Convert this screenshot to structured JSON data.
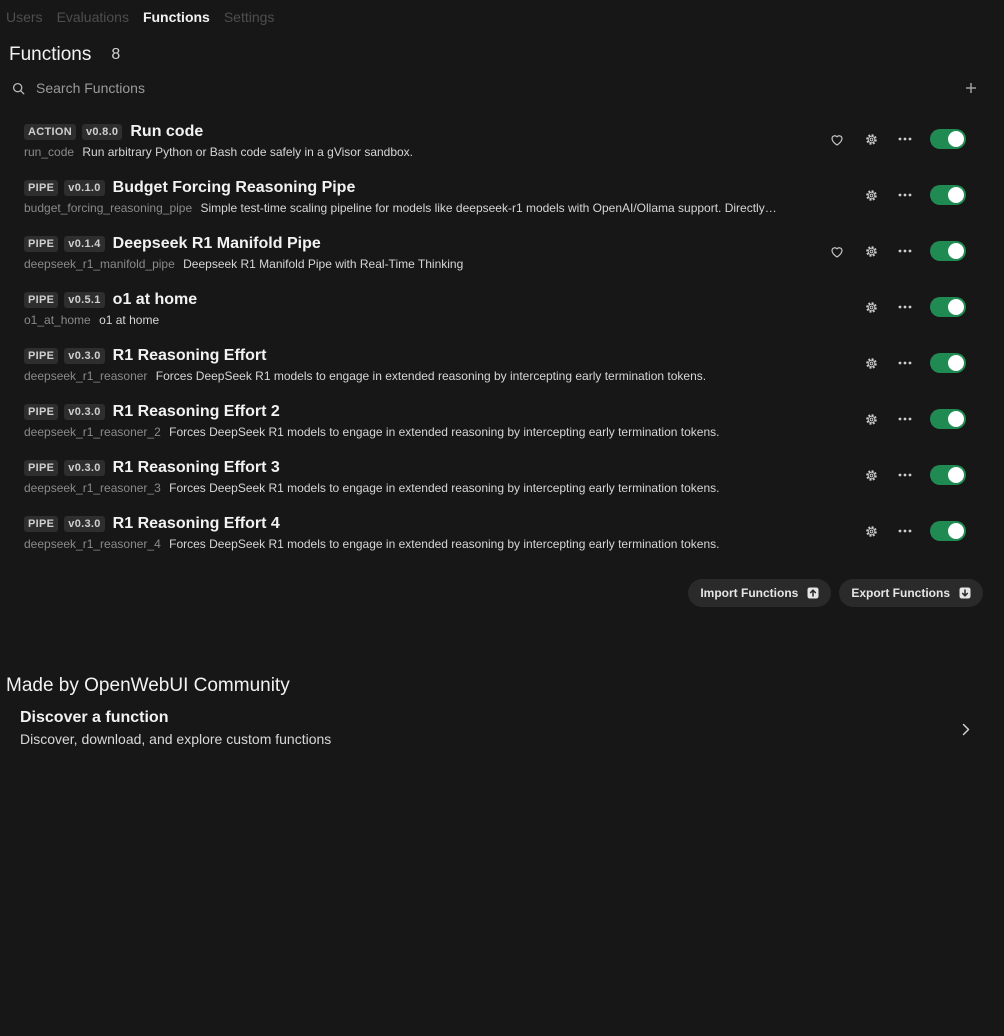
{
  "tabs": [
    {
      "label": "Users",
      "active": false
    },
    {
      "label": "Evaluations",
      "active": false
    },
    {
      "label": "Functions",
      "active": true
    },
    {
      "label": "Settings",
      "active": false
    }
  ],
  "heading": {
    "title": "Functions",
    "count": "8"
  },
  "search": {
    "placeholder": "Search Functions"
  },
  "functions": [
    {
      "type": "ACTION",
      "version": "v0.8.0",
      "name": "Run code",
      "id": "run_code",
      "description": "Run arbitrary Python or Bash code safely in a gVisor sandbox.",
      "heart": true,
      "enabled": true
    },
    {
      "type": "PIPE",
      "version": "v0.1.0",
      "name": "Budget Forcing Reasoning Pipe",
      "id": "budget_forcing_reasoning_pipe",
      "description": "Simple test-time scaling pipeline for models like deepseek-r1 models with OpenAI/Ollama support. Directly…",
      "heart": false,
      "enabled": true
    },
    {
      "type": "PIPE",
      "version": "v0.1.4",
      "name": "Deepseek R1 Manifold Pipe",
      "id": "deepseek_r1_manifold_pipe",
      "description": "Deepseek R1 Manifold Pipe with Real-Time Thinking",
      "heart": true,
      "enabled": true
    },
    {
      "type": "PIPE",
      "version": "v0.5.1",
      "name": "o1 at home",
      "id": "o1_at_home",
      "description": "o1 at home",
      "heart": false,
      "enabled": true
    },
    {
      "type": "PIPE",
      "version": "v0.3.0",
      "name": "R1 Reasoning Effort",
      "id": "deepseek_r1_reasoner",
      "description": "Forces DeepSeek R1 models to engage in extended reasoning by intercepting early termination tokens.",
      "heart": false,
      "enabled": true
    },
    {
      "type": "PIPE",
      "version": "v0.3.0",
      "name": "R1 Reasoning Effort 2",
      "id": "deepseek_r1_reasoner_2",
      "description": "Forces DeepSeek R1 models to engage in extended reasoning by intercepting early termination tokens.",
      "heart": false,
      "enabled": true
    },
    {
      "type": "PIPE",
      "version": "v0.3.0",
      "name": "R1 Reasoning Effort 3",
      "id": "deepseek_r1_reasoner_3",
      "description": "Forces DeepSeek R1 models to engage in extended reasoning by intercepting early termination tokens.",
      "heart": false,
      "enabled": true
    },
    {
      "type": "PIPE",
      "version": "v0.3.0",
      "name": "R1 Reasoning Effort 4",
      "id": "deepseek_r1_reasoner_4",
      "description": "Forces DeepSeek R1 models to engage in extended reasoning by intercepting early termination tokens.",
      "heart": false,
      "enabled": true
    }
  ],
  "actions": {
    "import_label": "Import Functions",
    "export_label": "Export Functions"
  },
  "community": {
    "title": "Made by OpenWebUI Community",
    "discover_title": "Discover a function",
    "discover_subtitle": "Discover, download, and explore custom functions"
  },
  "colors": {
    "background": "#171717",
    "toggle_on": "#1f8a52",
    "badge_bg": "#2e2e2e",
    "muted_text": "#8a8a8a"
  },
  "icons": {
    "search": "search-icon",
    "add": "plus-icon",
    "favorite": "heart-icon",
    "settings": "gear-icon",
    "more": "ellipsis-icon",
    "import": "upload-icon",
    "export": "download-icon",
    "discover": "chevron-right-icon"
  }
}
